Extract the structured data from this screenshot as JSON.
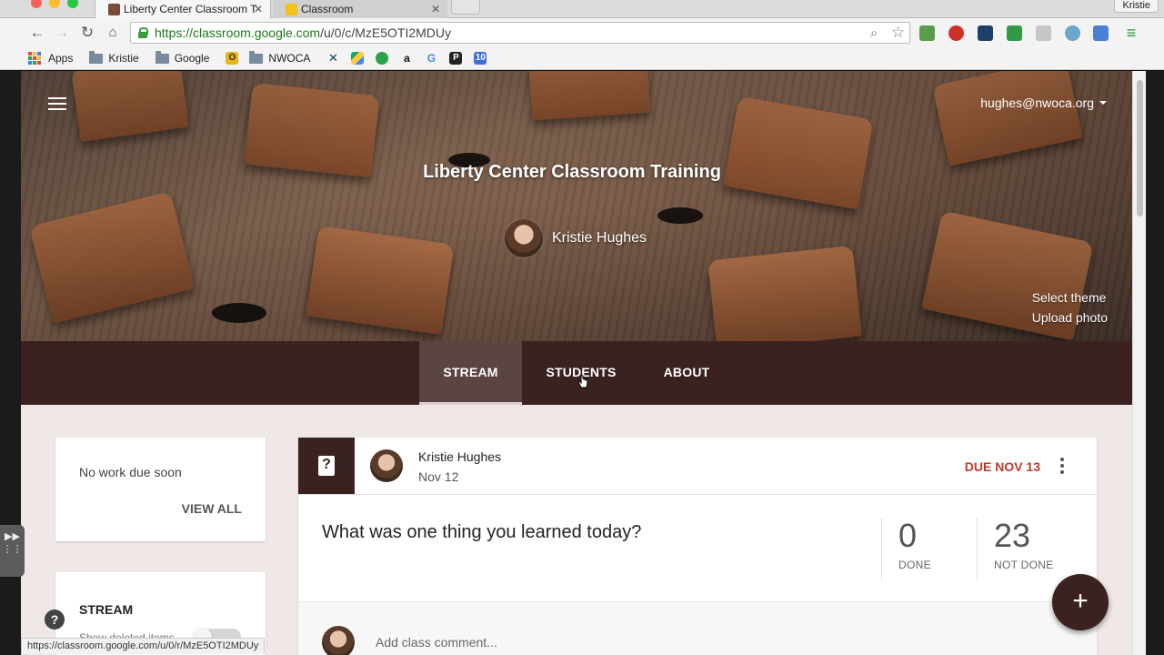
{
  "browser": {
    "tabs": [
      {
        "title": "Liberty Center Classroom T",
        "active": true
      },
      {
        "title": "Classroom",
        "active": false
      }
    ],
    "profile": "Kristie",
    "url_scheme": "https://",
    "url_host": "classroom.google.com",
    "url_path": "/u/0/c/MzE5OTI2MDUy",
    "bookmarks": [
      {
        "label": "Apps",
        "icon": "apps-grid-icon"
      },
      {
        "label": "Kristie",
        "icon": "folder-icon"
      },
      {
        "label": "Google",
        "icon": "folder-icon"
      },
      {
        "label": "",
        "icon": "outlook-icon"
      },
      {
        "label": "NWOCA",
        "icon": "folder-icon"
      }
    ],
    "status_url": "https://classroom.google.com/u/0/r/MzE5OTI2MDUy"
  },
  "header": {
    "account": "hughes@nwoca.org",
    "class_title": "Liberty Center Classroom Training",
    "teacher": "Kristie Hughes",
    "select_theme": "Select theme",
    "upload_photo": "Upload photo"
  },
  "nav_tabs": [
    {
      "label": "STREAM",
      "active": true
    },
    {
      "label": "STUDENTS",
      "active": false
    },
    {
      "label": "ABOUT",
      "active": false
    }
  ],
  "upcoming": {
    "message": "No work due soon",
    "view_all": "VIEW ALL"
  },
  "stream_settings": {
    "title": "STREAM",
    "show_deleted": "Show deleted items"
  },
  "post": {
    "author": "Kristie Hughes",
    "date": "Nov 12",
    "due": "DUE NOV 13",
    "question": "What was one thing you learned today?",
    "done_count": "0",
    "done_label": "DONE",
    "not_done_count": "23",
    "not_done_label": "NOT DONE",
    "comment_placeholder": "Add class comment..."
  },
  "colors": {
    "class_theme": "#3b2220",
    "due_red": "#c0392b"
  }
}
